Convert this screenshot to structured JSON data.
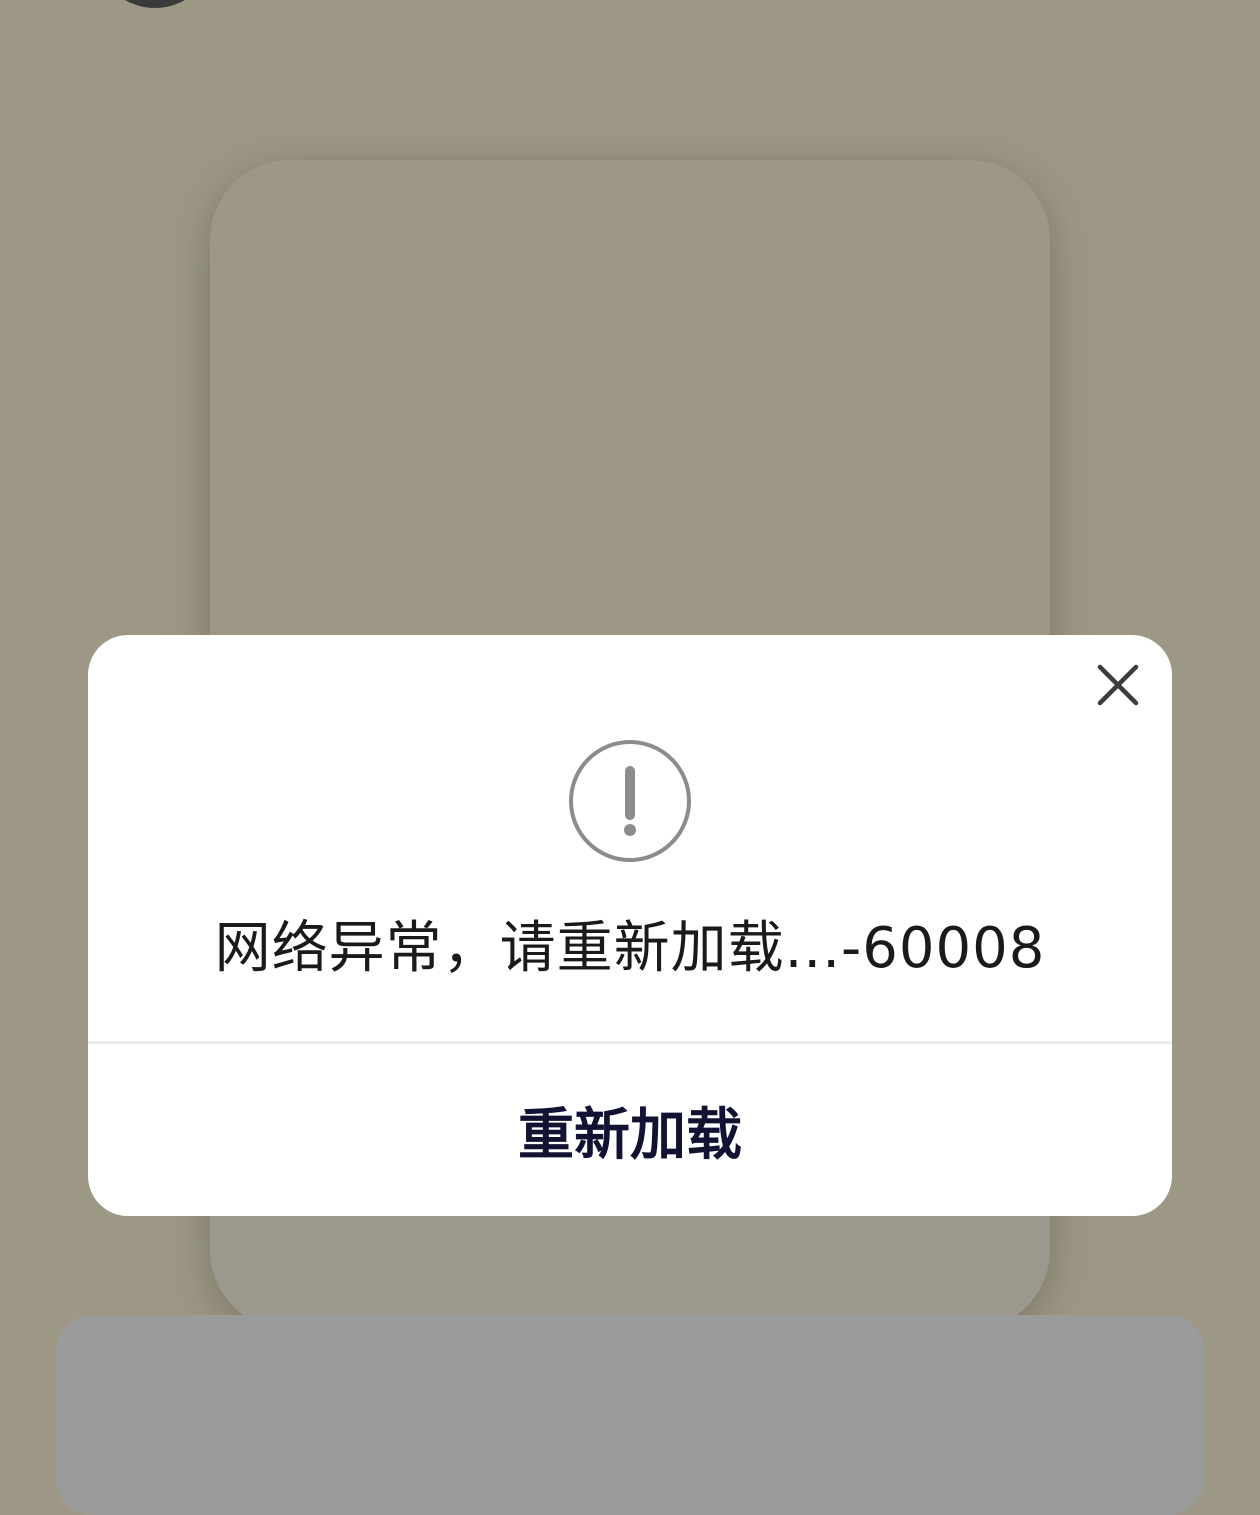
{
  "dialog": {
    "message": "网络异常，请重新加载...-60008",
    "reload_label": "重新加载",
    "close_icon": "close-icon",
    "alert_icon": "exclamation-circle-icon"
  },
  "colors": {
    "overlay_bg": "#9d9886",
    "dialog_bg": "#ffffff",
    "primary_text": "#121233",
    "icon_gray": "#8c8c8c"
  }
}
